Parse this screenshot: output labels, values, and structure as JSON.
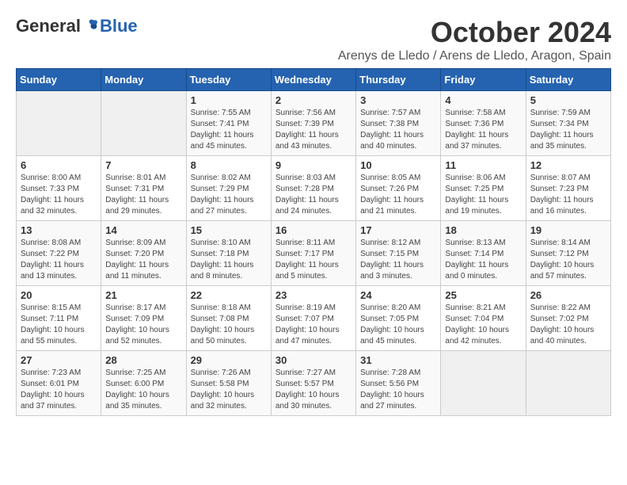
{
  "logo": {
    "general": "General",
    "blue": "Blue"
  },
  "header": {
    "month_year": "October 2024",
    "location": "Arenys de Lledo / Arens de Lledo, Aragon, Spain"
  },
  "weekdays": [
    "Sunday",
    "Monday",
    "Tuesday",
    "Wednesday",
    "Thursday",
    "Friday",
    "Saturday"
  ],
  "weeks": [
    [
      {
        "day": "",
        "info": ""
      },
      {
        "day": "",
        "info": ""
      },
      {
        "day": "1",
        "info": "Sunrise: 7:55 AM\nSunset: 7:41 PM\nDaylight: 11 hours and 45 minutes."
      },
      {
        "day": "2",
        "info": "Sunrise: 7:56 AM\nSunset: 7:39 PM\nDaylight: 11 hours and 43 minutes."
      },
      {
        "day": "3",
        "info": "Sunrise: 7:57 AM\nSunset: 7:38 PM\nDaylight: 11 hours and 40 minutes."
      },
      {
        "day": "4",
        "info": "Sunrise: 7:58 AM\nSunset: 7:36 PM\nDaylight: 11 hours and 37 minutes."
      },
      {
        "day": "5",
        "info": "Sunrise: 7:59 AM\nSunset: 7:34 PM\nDaylight: 11 hours and 35 minutes."
      }
    ],
    [
      {
        "day": "6",
        "info": "Sunrise: 8:00 AM\nSunset: 7:33 PM\nDaylight: 11 hours and 32 minutes."
      },
      {
        "day": "7",
        "info": "Sunrise: 8:01 AM\nSunset: 7:31 PM\nDaylight: 11 hours and 29 minutes."
      },
      {
        "day": "8",
        "info": "Sunrise: 8:02 AM\nSunset: 7:29 PM\nDaylight: 11 hours and 27 minutes."
      },
      {
        "day": "9",
        "info": "Sunrise: 8:03 AM\nSunset: 7:28 PM\nDaylight: 11 hours and 24 minutes."
      },
      {
        "day": "10",
        "info": "Sunrise: 8:05 AM\nSunset: 7:26 PM\nDaylight: 11 hours and 21 minutes."
      },
      {
        "day": "11",
        "info": "Sunrise: 8:06 AM\nSunset: 7:25 PM\nDaylight: 11 hours and 19 minutes."
      },
      {
        "day": "12",
        "info": "Sunrise: 8:07 AM\nSunset: 7:23 PM\nDaylight: 11 hours and 16 minutes."
      }
    ],
    [
      {
        "day": "13",
        "info": "Sunrise: 8:08 AM\nSunset: 7:22 PM\nDaylight: 11 hours and 13 minutes."
      },
      {
        "day": "14",
        "info": "Sunrise: 8:09 AM\nSunset: 7:20 PM\nDaylight: 11 hours and 11 minutes."
      },
      {
        "day": "15",
        "info": "Sunrise: 8:10 AM\nSunset: 7:18 PM\nDaylight: 11 hours and 8 minutes."
      },
      {
        "day": "16",
        "info": "Sunrise: 8:11 AM\nSunset: 7:17 PM\nDaylight: 11 hours and 5 minutes."
      },
      {
        "day": "17",
        "info": "Sunrise: 8:12 AM\nSunset: 7:15 PM\nDaylight: 11 hours and 3 minutes."
      },
      {
        "day": "18",
        "info": "Sunrise: 8:13 AM\nSunset: 7:14 PM\nDaylight: 11 hours and 0 minutes."
      },
      {
        "day": "19",
        "info": "Sunrise: 8:14 AM\nSunset: 7:12 PM\nDaylight: 10 hours and 57 minutes."
      }
    ],
    [
      {
        "day": "20",
        "info": "Sunrise: 8:15 AM\nSunset: 7:11 PM\nDaylight: 10 hours and 55 minutes."
      },
      {
        "day": "21",
        "info": "Sunrise: 8:17 AM\nSunset: 7:09 PM\nDaylight: 10 hours and 52 minutes."
      },
      {
        "day": "22",
        "info": "Sunrise: 8:18 AM\nSunset: 7:08 PM\nDaylight: 10 hours and 50 minutes."
      },
      {
        "day": "23",
        "info": "Sunrise: 8:19 AM\nSunset: 7:07 PM\nDaylight: 10 hours and 47 minutes."
      },
      {
        "day": "24",
        "info": "Sunrise: 8:20 AM\nSunset: 7:05 PM\nDaylight: 10 hours and 45 minutes."
      },
      {
        "day": "25",
        "info": "Sunrise: 8:21 AM\nSunset: 7:04 PM\nDaylight: 10 hours and 42 minutes."
      },
      {
        "day": "26",
        "info": "Sunrise: 8:22 AM\nSunset: 7:02 PM\nDaylight: 10 hours and 40 minutes."
      }
    ],
    [
      {
        "day": "27",
        "info": "Sunrise: 7:23 AM\nSunset: 6:01 PM\nDaylight: 10 hours and 37 minutes."
      },
      {
        "day": "28",
        "info": "Sunrise: 7:25 AM\nSunset: 6:00 PM\nDaylight: 10 hours and 35 minutes."
      },
      {
        "day": "29",
        "info": "Sunrise: 7:26 AM\nSunset: 5:58 PM\nDaylight: 10 hours and 32 minutes."
      },
      {
        "day": "30",
        "info": "Sunrise: 7:27 AM\nSunset: 5:57 PM\nDaylight: 10 hours and 30 minutes."
      },
      {
        "day": "31",
        "info": "Sunrise: 7:28 AM\nSunset: 5:56 PM\nDaylight: 10 hours and 27 minutes."
      },
      {
        "day": "",
        "info": ""
      },
      {
        "day": "",
        "info": ""
      }
    ]
  ]
}
